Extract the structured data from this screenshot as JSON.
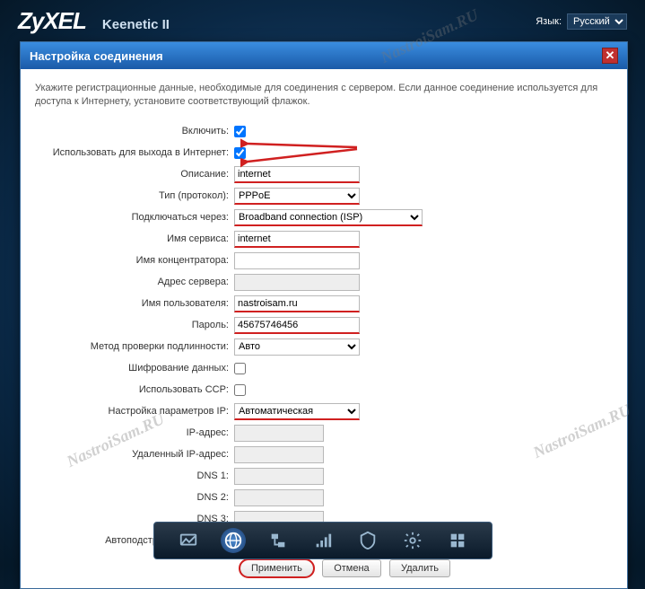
{
  "header": {
    "brand": "ZyXEL",
    "model": "Keenetic II",
    "lang_label": "Язык:",
    "lang_value": "Русский"
  },
  "dialog": {
    "title": "Настройка соединения",
    "intro": "Укажите регистрационные данные, необходимые для соединения с сервером. Если данное соединение используется для доступа к Интернету, установите соответствующий флажок."
  },
  "form": {
    "enable_label": "Включить:",
    "enable_checked": true,
    "inet_label": "Использовать для выхода в Интернет:",
    "inet_checked": true,
    "desc_label": "Описание:",
    "desc_value": "internet",
    "proto_label": "Тип (протокол):",
    "proto_value": "PPPoE",
    "via_label": "Подключаться через:",
    "via_value": "Broadband connection (ISP)",
    "service_label": "Имя сервиса:",
    "service_value": "internet",
    "concentrator_label": "Имя концентратора:",
    "concentrator_value": "",
    "server_label": "Адрес сервера:",
    "server_value": "",
    "user_label": "Имя пользователя:",
    "user_value": "nastroisam.ru",
    "pass_label": "Пароль:",
    "pass_value": "45675746456",
    "auth_label": "Метод проверки подлинности:",
    "auth_value": "Авто",
    "encrypt_label": "Шифрование данных:",
    "encrypt_checked": false,
    "ccp_label": "Использовать CCP:",
    "ccp_checked": false,
    "ipcfg_label": "Настройка параметров IP:",
    "ipcfg_value": "Автоматическая",
    "ip_label": "IP-адрес:",
    "ip_value": "",
    "remoteip_label": "Удаленный IP-адрес:",
    "remoteip_value": "",
    "dns1_label": "DNS 1:",
    "dns1_value": "",
    "dns2_label": "DNS 2:",
    "dns2_value": "",
    "dns3_label": "DNS 3:",
    "dns3_value": "",
    "tcpmss_label": "Автоподстройка TCP-MSS:",
    "tcpmss_checked": true
  },
  "buttons": {
    "apply": "Применить",
    "cancel": "Отмена",
    "delete": "Удалить"
  },
  "watermark": "NastroiSam.RU"
}
